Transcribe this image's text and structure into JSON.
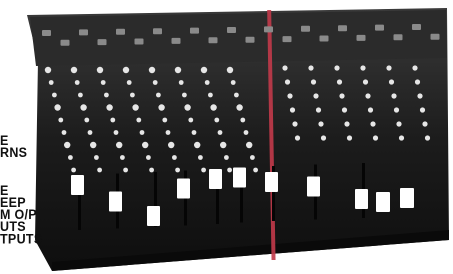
{
  "spec_text_top": [
    "E",
    "RNS"
  ],
  "spec_text_bottom": [
    "E",
    "EEP",
    "M O/P",
    "UTS",
    "TPUTS"
  ],
  "colors": {
    "page_background": "#ffffff",
    "mixer_body": "#161616",
    "mixer_panel": "#2a2a2a",
    "knob": "#e6e6e6",
    "fader_cap": "#ffffff",
    "meter_stripe": "#c23a4a",
    "label_text": "#111111"
  },
  "mixer": {
    "input_channel_strips": 8,
    "master_fader_count": 3,
    "icon": "audio-mixer-console-icon"
  }
}
